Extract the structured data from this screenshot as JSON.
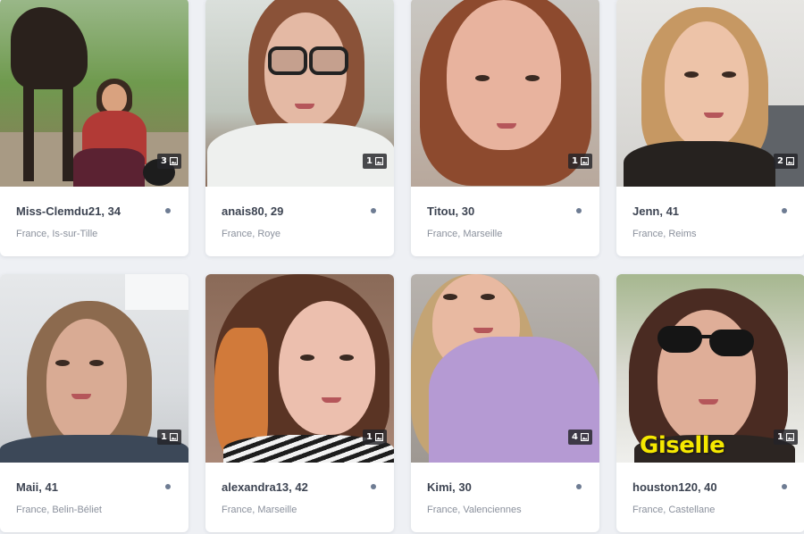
{
  "profiles": [
    {
      "name": "Miss-Clemdu21, 34",
      "location": "France, Is-sur-Tille",
      "photos": "3"
    },
    {
      "name": "anais80, 29",
      "location": "France, Roye",
      "photos": "1"
    },
    {
      "name": "Titou, 30",
      "location": "France, Marseille",
      "photos": "1"
    },
    {
      "name": "Jenn, 41",
      "location": "France, Reims",
      "photos": "2"
    },
    {
      "name": "Maii, 41",
      "location": "France, Belin-Béliet",
      "photos": "1"
    },
    {
      "name": "alexandra13, 42",
      "location": "France, Marseille",
      "photos": "1"
    },
    {
      "name": "Kimi, 30",
      "location": "France, Valenciennes",
      "photos": "4"
    },
    {
      "name": "houston120, 40",
      "location": "France, Castellane",
      "photos": "1",
      "watermark": "Giselle"
    }
  ],
  "icons": {
    "photo_count": "image-icon",
    "status": "status-dot-icon"
  },
  "colors": {
    "status_dot": "#6e7c93",
    "watermark": "#f5e800"
  }
}
